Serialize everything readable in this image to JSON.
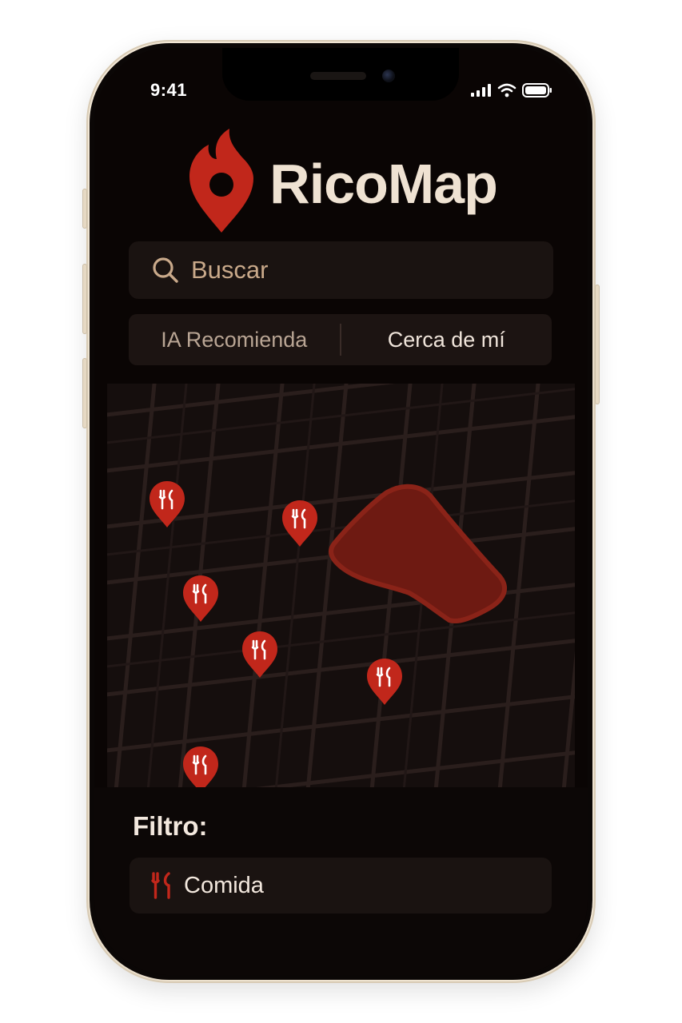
{
  "status_bar": {
    "time": "9:41"
  },
  "header": {
    "app_name": "RicoMap",
    "logo_icon": "flame-pin-icon"
  },
  "search": {
    "placeholder": "Buscar"
  },
  "tabs": [
    {
      "label": "IA Recomienda"
    },
    {
      "label": "Cerca de mí"
    }
  ],
  "filter": {
    "title": "Filtro:",
    "selected_label": "Comida",
    "icon": "fork-knife-icon"
  },
  "colors": {
    "accent": "#c1271b",
    "background": "#0a0504",
    "text_light": "#efe2d2"
  }
}
